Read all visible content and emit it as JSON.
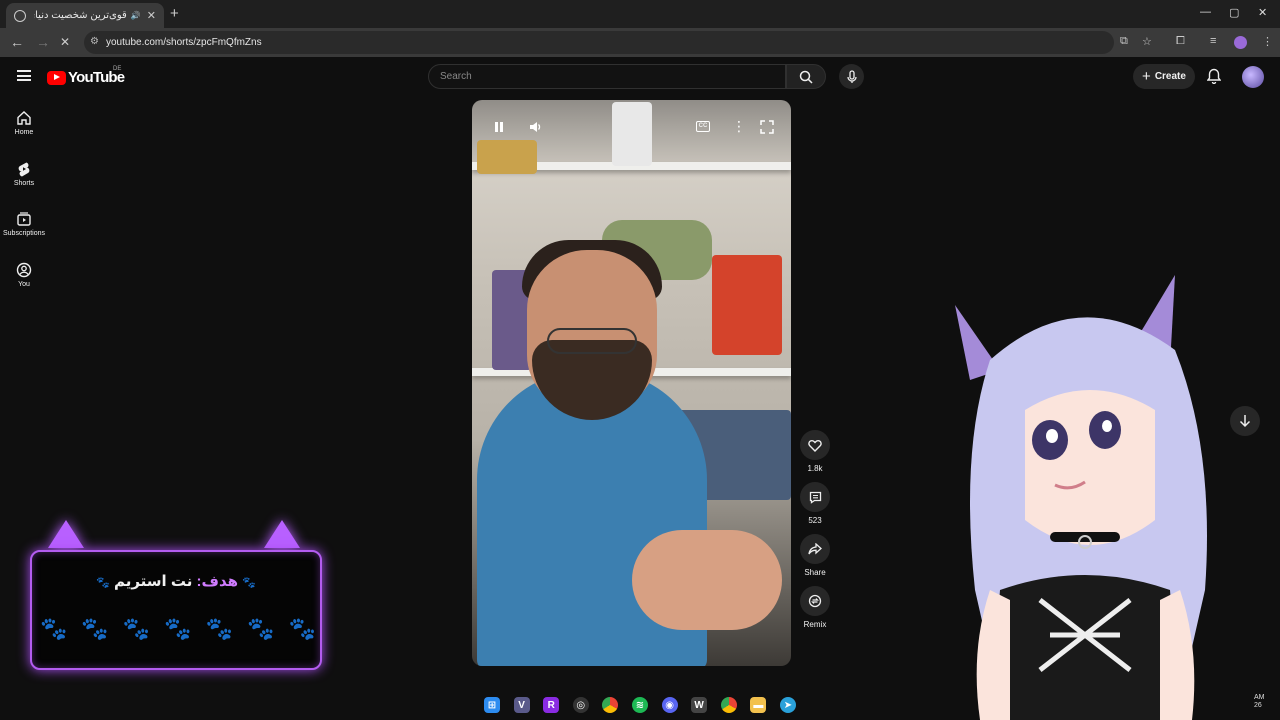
{
  "browser": {
    "tab_title": "قوی‌ترین شخصیت دنیای انیمه",
    "tab_close": "✕",
    "new_tab": "+",
    "url": "youtube.com/shorts/zpcFmQfmZns",
    "window_controls": {
      "minimize": "—",
      "maximize": "▢",
      "close": "✕"
    }
  },
  "youtube": {
    "logo_text": "YouTube",
    "logo_region": "DE",
    "search_placeholder": "Search",
    "create_label": "Create",
    "sidebar": [
      {
        "label": "Home",
        "icon": "home-icon"
      },
      {
        "label": "Shorts",
        "icon": "shorts-icon"
      },
      {
        "label": "Subscriptions",
        "icon": "subscriptions-icon"
      },
      {
        "label": "You",
        "icon": "account-icon"
      }
    ],
    "actions": {
      "like_count": "1.8k",
      "comment_count": "523",
      "share_label": "Share",
      "remix_label": "Remix"
    },
    "video_controls": {
      "cc": "CC"
    }
  },
  "overlay": {
    "goal_prefix": "هدف:",
    "goal_text": " نت استریم",
    "paws_filled": 3,
    "paws_total": 7
  },
  "system": {
    "clock_line1": "AM",
    "clock_line2": "26"
  },
  "colors": {
    "accent_purple": "#b35cf0",
    "youtube_red": "#ff0000",
    "paw_on": "#e458e0",
    "paw_off": "#c8c8c8"
  }
}
